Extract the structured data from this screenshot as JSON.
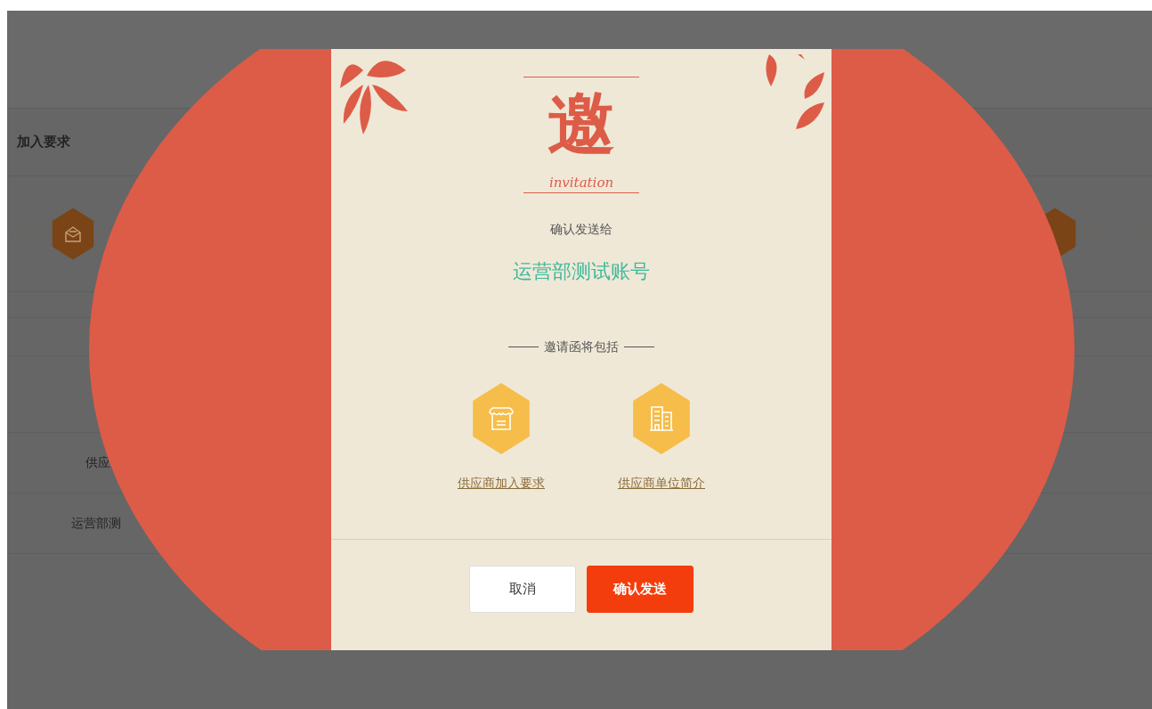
{
  "page": {
    "section_title": "加入要求",
    "rows": [
      {
        "text": "供应"
      },
      {
        "text": "运营部测"
      }
    ]
  },
  "dialog": {
    "seal": "邀",
    "seal_caption": "invitation",
    "prompt": "确认发送给",
    "recipient": "运营部测试账号",
    "includes_heading": "邀请函将包括",
    "items": [
      {
        "kind": "store",
        "label": "供应商加入要求"
      },
      {
        "kind": "building",
        "label": "供应商单位简介"
      }
    ],
    "buttons": [
      {
        "kind": "secondary",
        "label": "取消"
      },
      {
        "kind": "primary",
        "label": "确认发送"
      }
    ]
  }
}
